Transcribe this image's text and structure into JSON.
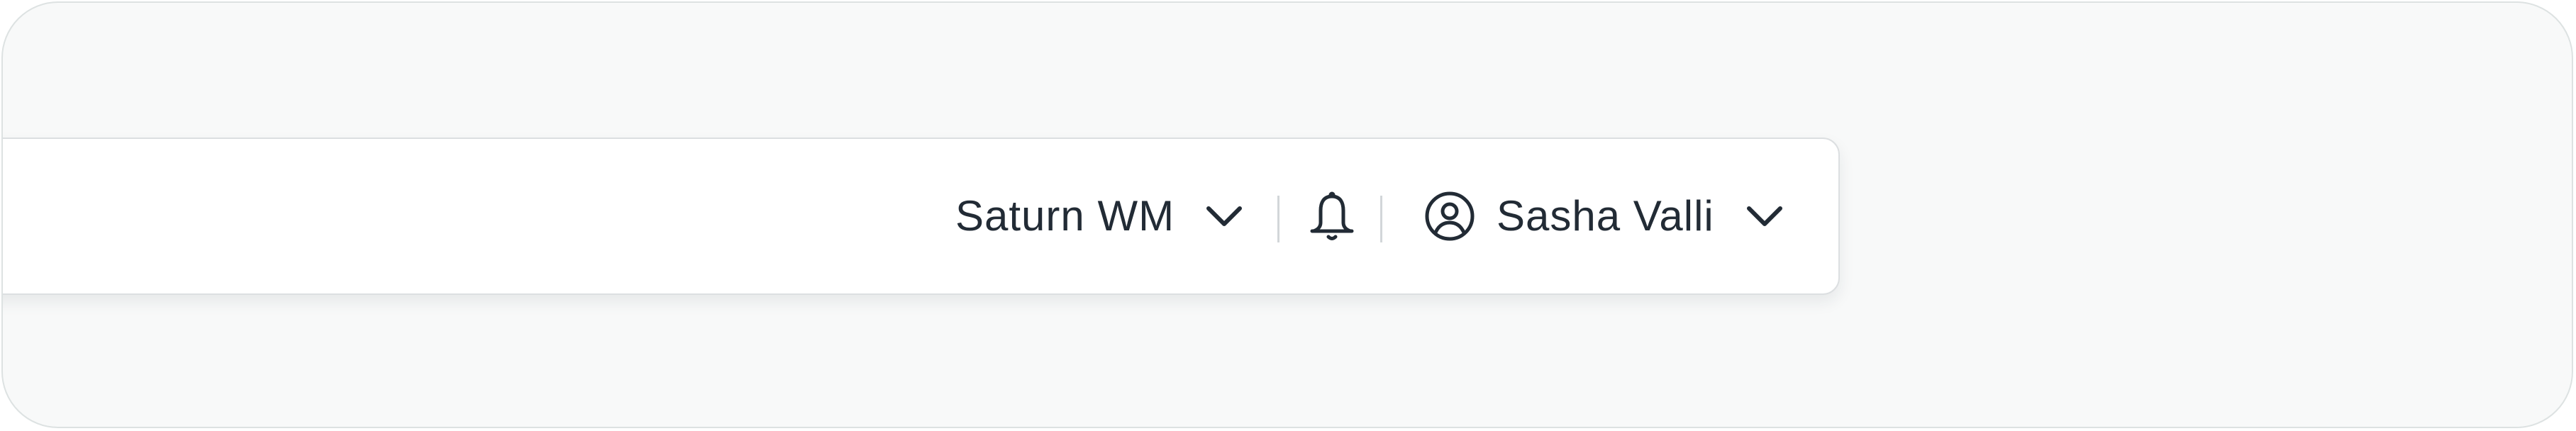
{
  "topbar": {
    "workspace": {
      "label": "Saturn WM",
      "icon": "chevron-down-icon"
    },
    "notifications": {
      "icon": "bell-icon"
    },
    "user": {
      "name": "Sasha Valli",
      "avatar_icon": "user-circle-icon",
      "menu_icon": "chevron-down-icon"
    }
  },
  "colors": {
    "page_background": "#f8f9f9",
    "bar_background": "#ffffff",
    "text": "#222b35",
    "divider": "#d2d6d9"
  }
}
